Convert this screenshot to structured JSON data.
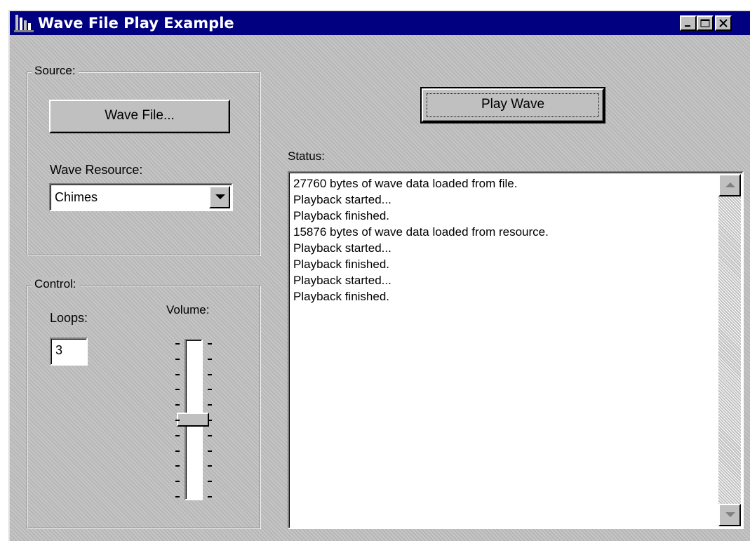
{
  "window": {
    "title": "Wave File Play Example"
  },
  "source": {
    "group_label": "Source:",
    "wave_file_button": "Wave File...",
    "wave_resource_label": "Wave Resource:",
    "wave_resource_selected": "Chimes"
  },
  "control": {
    "group_label": "Control:",
    "loops_label": "Loops:",
    "loops_value": "3",
    "volume_label": "Volume:",
    "volume_level_percent": 50
  },
  "play_button": "Play Wave",
  "status": {
    "label": "Status:",
    "lines": [
      "27760 bytes of wave data loaded from file.",
      "Playback started...",
      "Playback finished.",
      "15876 bytes of wave data loaded from resource.",
      "Playback started...",
      "Playback finished.",
      "Playback started...",
      "Playback finished."
    ]
  },
  "icons": {
    "app": "app-icon",
    "minimize": "minimize-icon",
    "maximize": "maximize-icon",
    "close": "close-icon",
    "dropdown": "chevron-down-icon",
    "scroll_up": "scroll-up-arrow-icon",
    "scroll_down": "scroll-down-arrow-icon"
  },
  "colors": {
    "titlebar": "#000080",
    "face": "#c0c0c0"
  }
}
